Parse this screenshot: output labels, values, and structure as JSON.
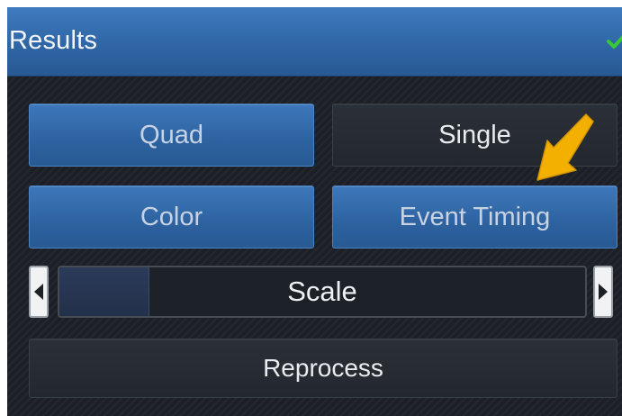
{
  "header": {
    "title": "Results",
    "status_icon": "checkmark-icon",
    "status_color": "#38c838"
  },
  "buttons": {
    "quad": "Quad",
    "single": "Single",
    "color": "Color",
    "event_timing": "Event Timing",
    "reprocess": "Reprocess"
  },
  "scale": {
    "label": "Scale",
    "level": 0.17,
    "left_icon": "left-arrow-icon",
    "right_icon": "right-arrow-icon"
  },
  "colors": {
    "accent": "#2f66a6",
    "panel": "#1c2026",
    "callout": "#f4b000"
  }
}
